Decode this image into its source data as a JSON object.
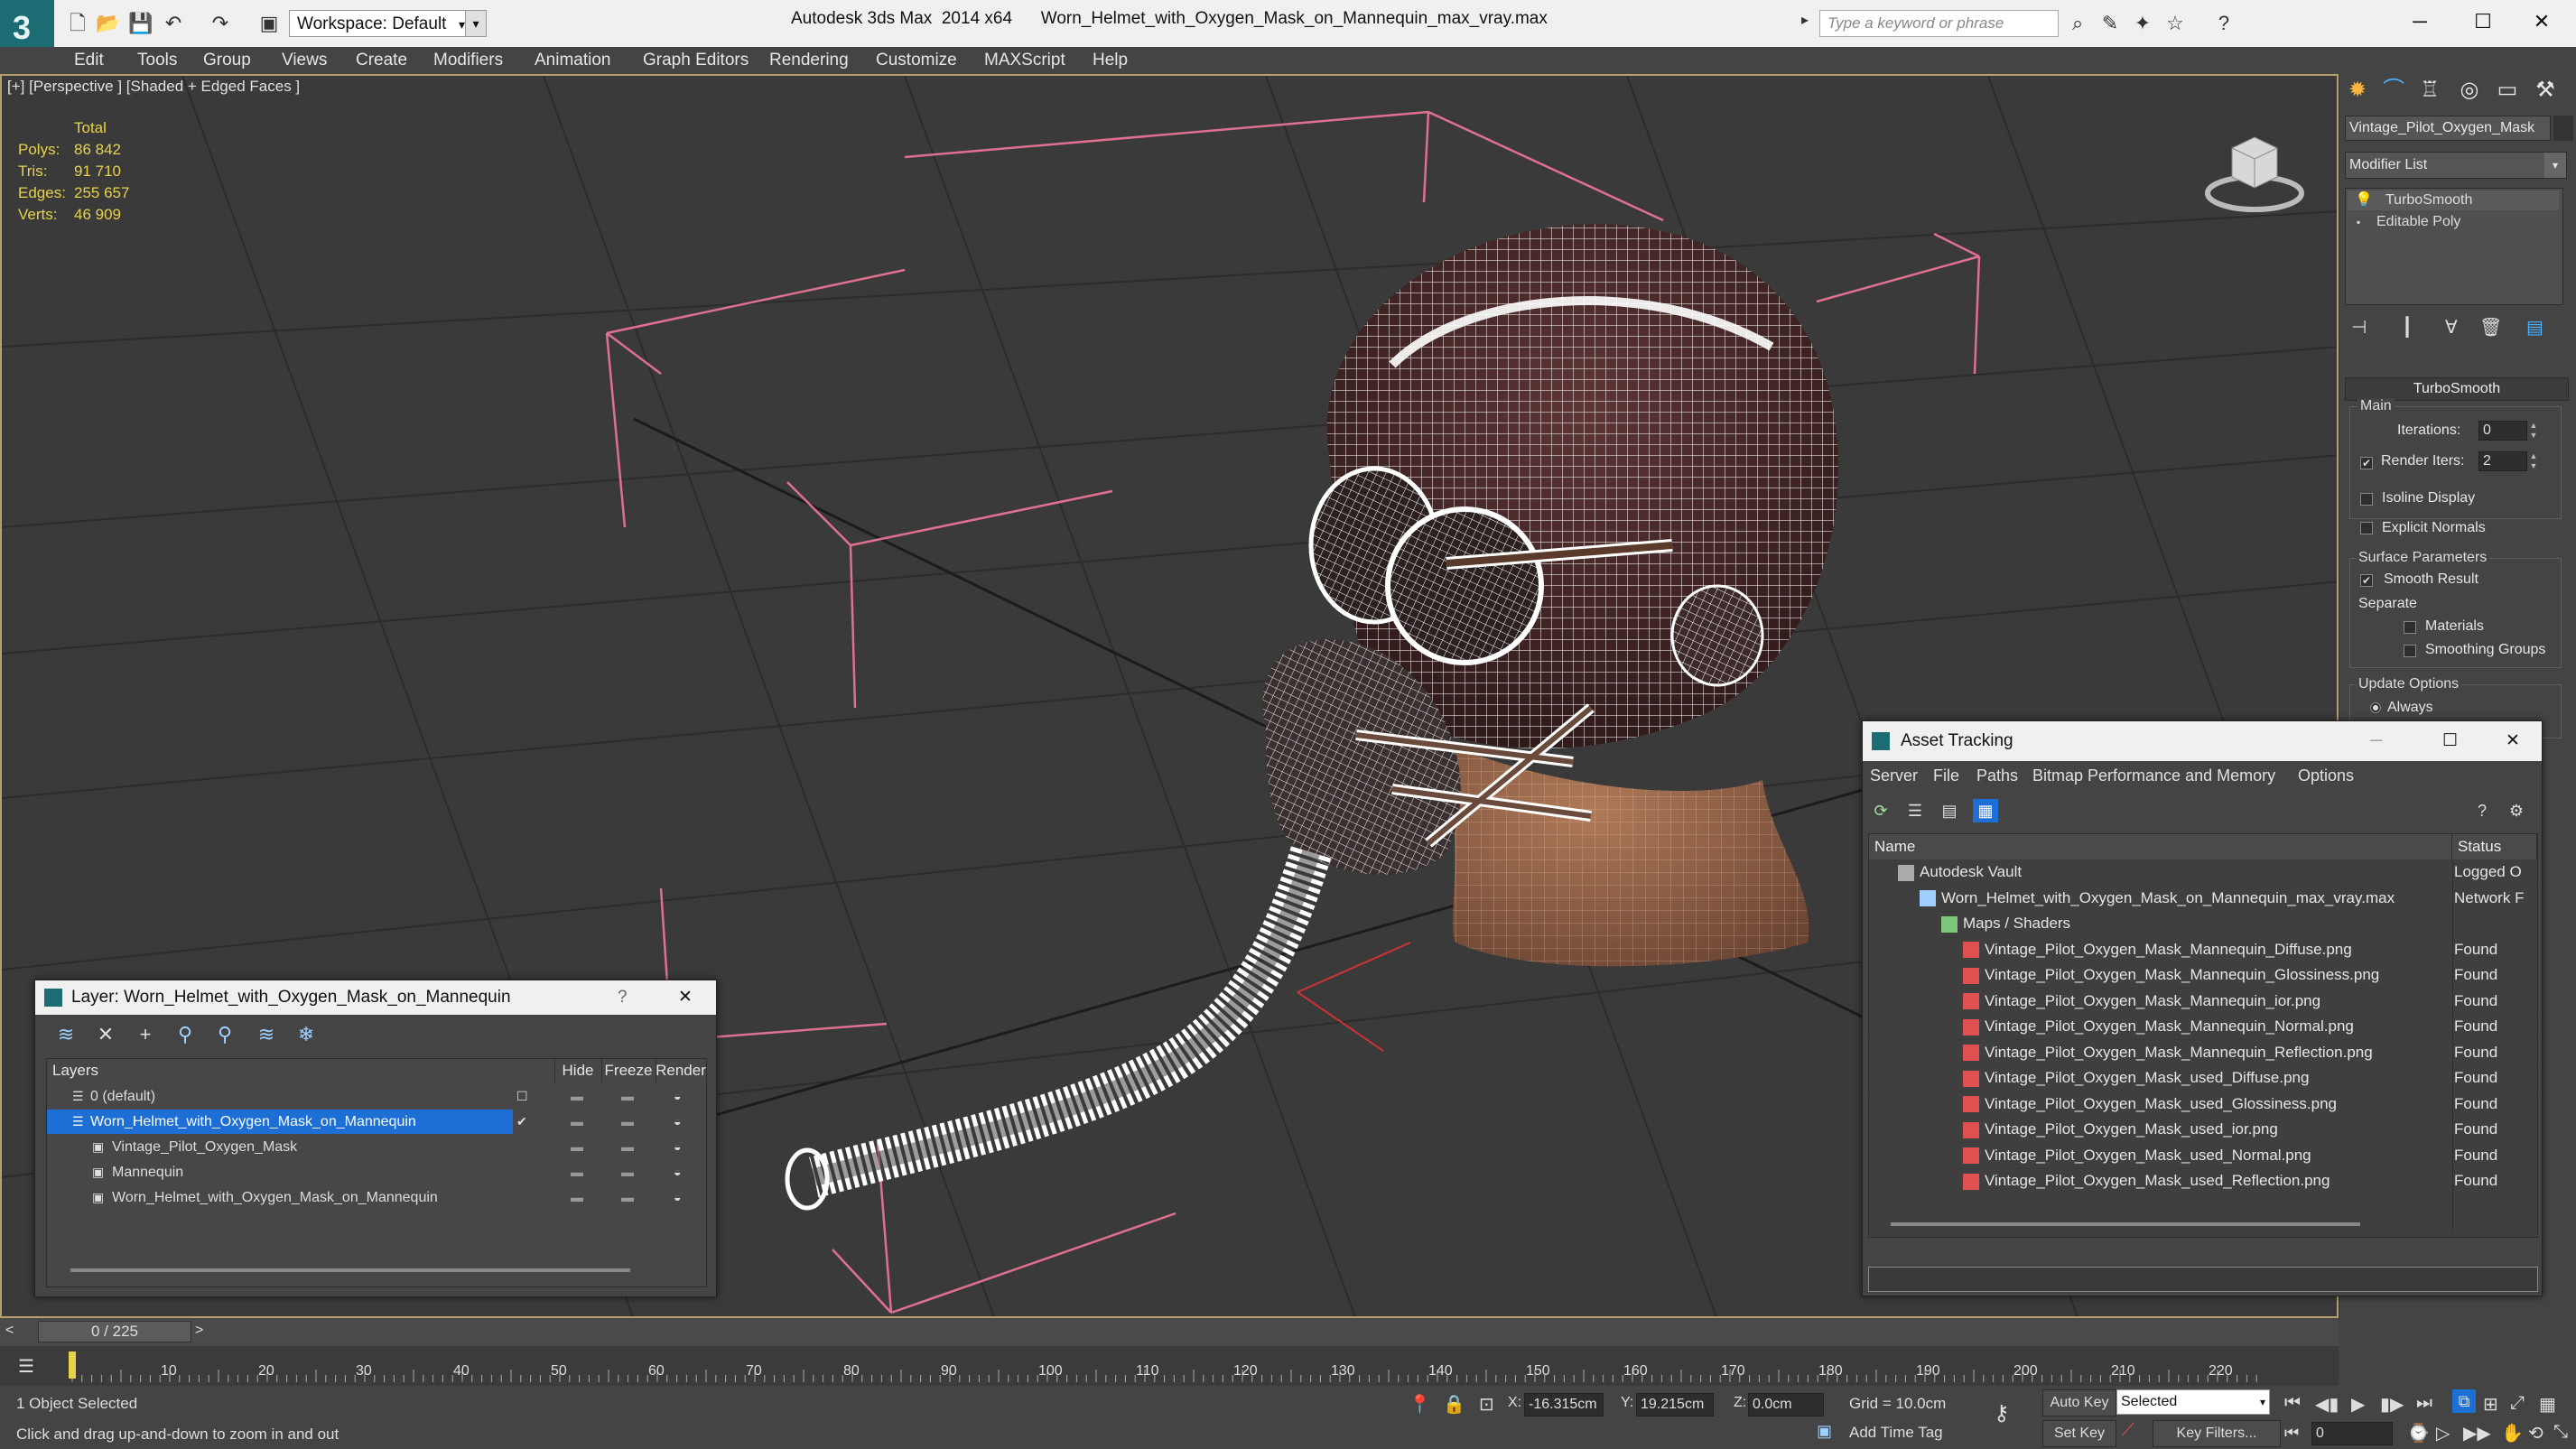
{
  "titlebar": {
    "workspace": "Workspace: Default",
    "app_name": "Autodesk 3ds Max  2014 x64",
    "file_name": "Worn_Helmet_with_Oxygen_Mask_on_Mannequin_max_vray.max",
    "search_placeholder": "Type a keyword or phrase",
    "logo": "3ds-max-logo"
  },
  "menubar": {
    "items": [
      "Edit",
      "Tools",
      "Group",
      "Views",
      "Create",
      "Modifiers",
      "Animation",
      "Graph Editors",
      "Rendering",
      "Customize",
      "MAXScript",
      "Help"
    ]
  },
  "viewport": {
    "label": "[+] [Perspective ] [Shaded + Edged Faces ]",
    "stats": {
      "header": "Total",
      "rows": [
        {
          "label": "Polys:",
          "value": "86 842"
        },
        {
          "label": "Tris:",
          "value": "91 710"
        },
        {
          "label": "Edges:",
          "value": "255 657"
        },
        {
          "label": "Verts:",
          "value": "46 909"
        }
      ]
    }
  },
  "command_panel": {
    "object_name": "Vintage_Pilot_Oxygen_Mask",
    "modifier_list": "Modifier List",
    "stack": [
      "TurboSmooth",
      "Editable Poly"
    ],
    "turbosmooth": {
      "title": "TurboSmooth",
      "main_label": "Main",
      "iterations_label": "Iterations:",
      "iterations_value": "0",
      "render_iters_label": "Render Iters:",
      "render_iters_value": "2",
      "render_iters_checked": true,
      "isoline_label": "Isoline Display",
      "explicit_label": "Explicit Normals",
      "surface_label": "Surface Parameters",
      "smooth_result_label": "Smooth Result",
      "smooth_result_checked": true,
      "separate_label": "Separate",
      "materials_label": "Materials",
      "smoothing_groups_label": "Smoothing Groups",
      "update_label": "Update Options",
      "always_label": "Always"
    }
  },
  "layer_dialog": {
    "title": "Layer: Worn_Helmet_with_Oxygen_Mask_on_Mannequin",
    "help": "?",
    "columns": [
      "Layers",
      "Hide",
      "Freeze",
      "Render"
    ],
    "rows": [
      {
        "name": "0 (default)",
        "indent": 0,
        "kind": "layer"
      },
      {
        "name": "Worn_Helmet_with_Oxygen_Mask_on_Mannequin",
        "indent": 0,
        "kind": "layer",
        "selected": true
      },
      {
        "name": "Vintage_Pilot_Oxygen_Mask",
        "indent": 1,
        "kind": "object"
      },
      {
        "name": "Mannequin",
        "indent": 1,
        "kind": "object"
      },
      {
        "name": "Worn_Helmet_with_Oxygen_Mask_on_Mannequin",
        "indent": 1,
        "kind": "object"
      }
    ]
  },
  "asset_tracking": {
    "title": "Asset Tracking",
    "menu": [
      "Server",
      "File",
      "Paths",
      "Bitmap Performance and Memory",
      "Options"
    ],
    "columns": [
      "Name",
      "Status"
    ],
    "rows": [
      {
        "name": "Autodesk Vault",
        "status": "Logged O",
        "indent": 1,
        "icon": "vault"
      },
      {
        "name": "Worn_Helmet_with_Oxygen_Mask_on_Mannequin_max_vray.max",
        "status": "Network F",
        "indent": 2,
        "icon": "max"
      },
      {
        "name": "Maps / Shaders",
        "status": "",
        "indent": 3,
        "icon": "folder"
      },
      {
        "name": "Vintage_Pilot_Oxygen_Mask_Mannequin_Diffuse.png",
        "status": "Found",
        "indent": 4,
        "icon": "png"
      },
      {
        "name": "Vintage_Pilot_Oxygen_Mask_Mannequin_Glossiness.png",
        "status": "Found",
        "indent": 4,
        "icon": "png"
      },
      {
        "name": "Vintage_Pilot_Oxygen_Mask_Mannequin_ior.png",
        "status": "Found",
        "indent": 4,
        "icon": "png"
      },
      {
        "name": "Vintage_Pilot_Oxygen_Mask_Mannequin_Normal.png",
        "status": "Found",
        "indent": 4,
        "icon": "png"
      },
      {
        "name": "Vintage_Pilot_Oxygen_Mask_Mannequin_Reflection.png",
        "status": "Found",
        "indent": 4,
        "icon": "png"
      },
      {
        "name": "Vintage_Pilot_Oxygen_Mask_used_Diffuse.png",
        "status": "Found",
        "indent": 4,
        "icon": "png"
      },
      {
        "name": "Vintage_Pilot_Oxygen_Mask_used_Glossiness.png",
        "status": "Found",
        "indent": 4,
        "icon": "png"
      },
      {
        "name": "Vintage_Pilot_Oxygen_Mask_used_ior.png",
        "status": "Found",
        "indent": 4,
        "icon": "png"
      },
      {
        "name": "Vintage_Pilot_Oxygen_Mask_used_Normal.png",
        "status": "Found",
        "indent": 4,
        "icon": "png"
      },
      {
        "name": "Vintage_Pilot_Oxygen_Mask_used_Reflection.png",
        "status": "Found",
        "indent": 4,
        "icon": "png"
      }
    ]
  },
  "timeline": {
    "frame": "0 / 225",
    "ticks": [
      "10",
      "20",
      "30",
      "40",
      "50",
      "60",
      "70",
      "80",
      "90",
      "100",
      "110",
      "120",
      "130",
      "140",
      "150",
      "160",
      "170",
      "180",
      "190",
      "200",
      "210",
      "220"
    ]
  },
  "statusbar": {
    "selection": "1 Object Selected",
    "prompt": "Click and drag up-and-down to zoom in and out",
    "x_label": "X:",
    "x_value": "-16.315cm",
    "y_label": "Y:",
    "y_value": "19.215cm",
    "z_label": "Z:",
    "z_value": "0.0cm",
    "grid": "Grid = 10.0cm",
    "auto_key": "Auto Key",
    "selected": "Selected",
    "set_key": "Set Key",
    "key_filters": "Key Filters...",
    "add_time_tag": "Add Time Tag",
    "frame_field": "0"
  },
  "colors": {
    "accent_selection": "#1d6fd6",
    "stats_text": "#e8d24a",
    "wire": "#ffffff",
    "helmet_fill": "#4a2a2a",
    "skin_fill": "#8a5a40",
    "bbox_lines": "#e07090"
  }
}
